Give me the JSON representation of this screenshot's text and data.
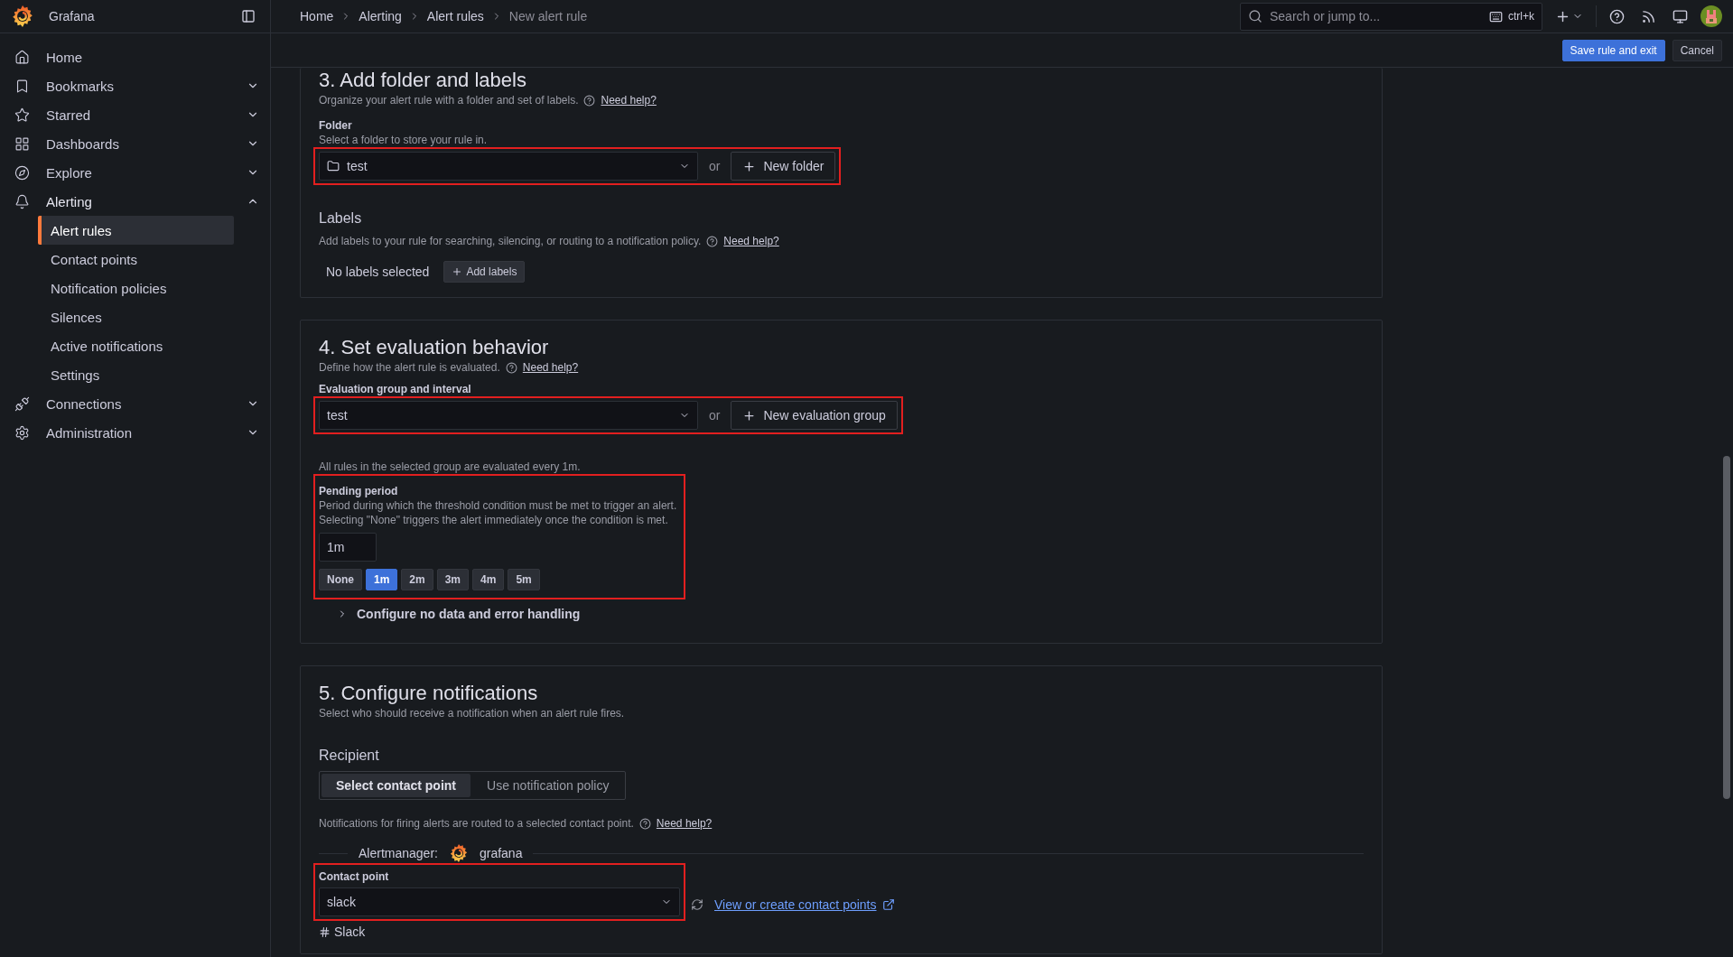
{
  "sidebar": {
    "brand": "Grafana",
    "items": [
      {
        "label": "Home",
        "expandable": false,
        "expanded": false
      },
      {
        "label": "Bookmarks",
        "expandable": true,
        "expanded": false
      },
      {
        "label": "Starred",
        "expandable": true,
        "expanded": false
      },
      {
        "label": "Dashboards",
        "expandable": true,
        "expanded": false
      },
      {
        "label": "Explore",
        "expandable": true,
        "expanded": false
      },
      {
        "label": "Alerting",
        "expandable": true,
        "expanded": true,
        "children": [
          {
            "label": "Alert rules",
            "selected": true
          },
          {
            "label": "Contact points",
            "selected": false
          },
          {
            "label": "Notification policies",
            "selected": false
          },
          {
            "label": "Silences",
            "selected": false
          },
          {
            "label": "Active notifications",
            "selected": false
          },
          {
            "label": "Settings",
            "selected": false
          }
        ]
      },
      {
        "label": "Connections",
        "expandable": true,
        "expanded": false
      },
      {
        "label": "Administration",
        "expandable": true,
        "expanded": false
      }
    ]
  },
  "breadcrumbs": [
    "Home",
    "Alerting",
    "Alert rules",
    "New alert rule"
  ],
  "search": {
    "placeholder": "Search or jump to...",
    "shortcut": "ctrl+k"
  },
  "actions": [
    {
      "label": "Save rule and exit",
      "kind": "primary"
    },
    {
      "label": "Cancel",
      "kind": "secondary"
    }
  ],
  "folder_section": {
    "title": "3. Add folder and labels",
    "description": "Organize your alert rule with a folder and set of labels.",
    "help": "Need help?",
    "folder": {
      "label": "Folder",
      "description": "Select a folder to store your rule in.",
      "value": "test",
      "or": "or",
      "button": "New folder",
      "highlighted": true
    },
    "labels": {
      "title": "Labels",
      "description": "Add labels to your rule for searching, silencing, or routing to a notification policy.",
      "help": "Need help?",
      "empty": "No labels selected",
      "button": "Add labels"
    }
  },
  "evaluation_section": {
    "title": "4. Set evaluation behavior",
    "description": "Define how the alert rule is evaluated.",
    "help": "Need help?",
    "group": {
      "label": "Evaluation group and interval",
      "value": "test",
      "or": "or",
      "button": "New evaluation group",
      "highlighted": true
    },
    "note": "All rules in the selected group are evaluated every 1m.",
    "pending": {
      "label": "Pending period",
      "description": [
        "Period during which the threshold condition must be met to trigger an alert.",
        "Selecting \"None\" triggers the alert immediately once the condition is met."
      ],
      "value": "1m",
      "highlighted": true,
      "presets": [
        {
          "label": "None",
          "selected": false
        },
        {
          "label": "1m",
          "selected": true
        },
        {
          "label": "2m",
          "selected": false
        },
        {
          "label": "3m",
          "selected": false
        },
        {
          "label": "4m",
          "selected": false
        },
        {
          "label": "5m",
          "selected": false
        }
      ]
    },
    "more": {
      "label": "Configure no data and error handling",
      "expanded": false
    }
  },
  "notifications_section": {
    "title": "5. Configure notifications",
    "description": "Select who should receive a notification when an alert rule fires.",
    "recipient": {
      "title": "Recipient",
      "options": [
        {
          "label": "Select contact point",
          "selected": true
        },
        {
          "label": "Use notification policy",
          "selected": false
        }
      ]
    },
    "note": "Notifications for firing alerts are routed to a selected contact point.",
    "help": "Need help?",
    "alertmanager": {
      "label": "Alertmanager:",
      "name": "grafana"
    },
    "contact": {
      "label": "Contact point",
      "value": "slack",
      "link": "View or create contact points",
      "highlighted": true
    },
    "integration": "Slack"
  }
}
